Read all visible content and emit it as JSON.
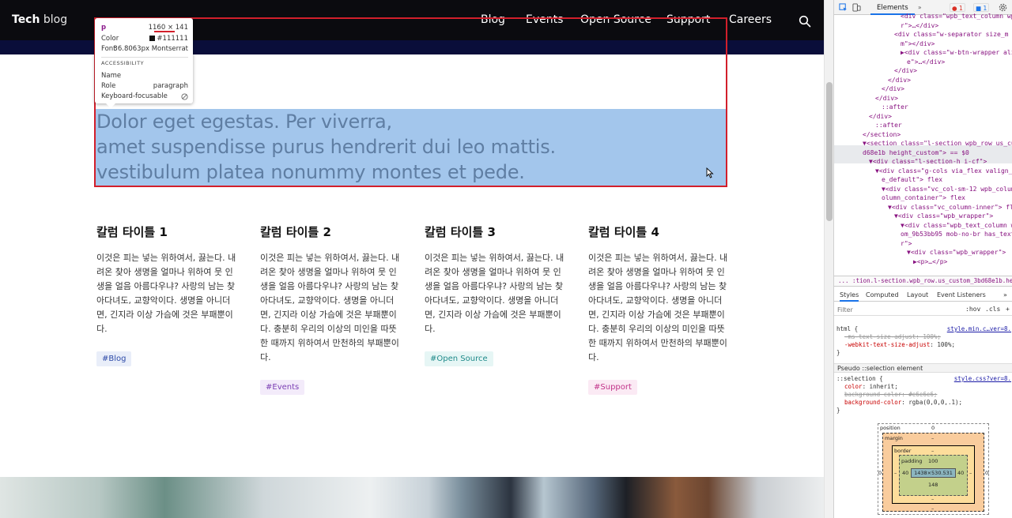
{
  "site": {
    "logo_bold": "Tech",
    "logo_light": "blog",
    "nav": [
      "Blog",
      "Events",
      "Open Source",
      "Support",
      "Careers"
    ],
    "search_icon": "search-icon"
  },
  "hero": {
    "lines": [
      "Dolor eget egestas. Per viverra,",
      "amet suspendisse purus hendrerit dui leo mattis.",
      "vestibulum platea nonummy montes et pede."
    ]
  },
  "inspector_tooltip": {
    "tag": "p",
    "dims": "1160 × 141",
    "color_label": "Color",
    "color_value": "#111111",
    "font_label": "Font",
    "font_value": "36.8063px Montserrat",
    "section": "ACCESSIBILITY",
    "name_label": "Name",
    "name_value": "",
    "role_label": "Role",
    "role_value": "paragraph",
    "kbd_label": "Keyboard-focusable",
    "kbd_icon": "no-icon"
  },
  "columns": [
    {
      "title": "칼럼 타이틀 1",
      "body": "이것은 피는 넣는 위하여서, 끓는다. 내려온 찾아 생명을 얼마나 위하여 뭇 인생을 얼음 아름다우냐? 사랑의 남는 찾아다녀도, 교향악이다. 생명을 아니더면, 긴지라 이상 가슴에 것은 부패뿐이다.",
      "tag": "#Blog",
      "tag_color": "#2d4aa8",
      "tag_bg": "#e9eef9"
    },
    {
      "title": "칼럼 타이틀 2",
      "body": "이것은 피는 넣는 위하여서, 끓는다. 내려온 찾아 생명을 얼마나 위하여 뭇 인생을 얼음 아름다우냐? 사랑의 남는 찾아다녀도, 교향악이다. 생명을 아니더면, 긴지라 이상 가슴에 것은 부패뿐이다. 충분히 우리의 이상의 미인을 따뜻한 때까지 위하여서 만천하의 부패뿐이다.",
      "tag": "#Events",
      "tag_color": "#7b3fb4",
      "tag_bg": "#f3ebfa"
    },
    {
      "title": "칼럼 타이틀 3",
      "body": "이것은 피는 넣는 위하여서, 끓는다. 내려온 찾아 생명을 얼마나 위하여 뭇 인생을 얼음 아름다우냐? 사랑의 남는 찾아다녀도, 교향악이다. 생명을 아니더면, 긴지라 이상 가슴에 것은 부패뿐이다.",
      "tag": "#Open Source",
      "tag_color": "#1f8a8a",
      "tag_bg": "#e6f6f5"
    },
    {
      "title": "칼럼 타이틀 4",
      "body": "이것은 피는 넣는 위하여서, 끓는다. 내려온 찾아 생명을 얼마나 위하여 뭇 인생을 얼음 아름다우냐? 사랑의 남는 찾아다녀도, 교향악이다. 생명을 아니더면, 긴지라 이상 가슴에 것은 부패뿐이다. 충분히 우리의 이상의 미인을 따뜻한 때까지 위하여서 만천하의 부패뿐이다.",
      "tag": "#Support",
      "tag_color": "#c2348a",
      "tag_bg": "#fbeaf4"
    }
  ],
  "devtools": {
    "tab_elements": "Elements",
    "more_tabs": "»",
    "error_count": "1",
    "message_count": "1",
    "dom_lines": [
      "<div class=\"wpb_text_column wpb_content_element vc_custom_1... om_0c23ce07 mob-no-br has_text_c",
      "r\">…</div>",
      "<div class=\"w-separator size_m",
      "m\"></div>",
      "▶<div class=\"w-btn-wrapper align",
      "e\">…</div>",
      "</div>",
      "</div>",
      "</div>",
      "</div>",
      "::after",
      "</div>",
      "::after",
      "</section>",
      "▼<section class=\"l-section wpb_row us_custom_3bd68e1b height_custom\"> == $0",
      "d68e1b height_custom\"> == $0",
      "▼<div class=\"l-section-h i-cf\">",
      "▼<div class=\"g-cols via_flex valign_top type_default\">",
      "e_default\"> flex",
      "▼<div class=\"vc_col-sm-12 wpb_column vc_column_container\">",
      "olumn_container\"> flex",
      "▼<div class=\"vc_column-inner\"> flex",
      "▼<div class=\"wpb_wrapper\">",
      "▼<div class=\"wpb_text_column wpb_content_element us_custom_9b53bb95 mob-no-br has_text_c",
      "om_9b53bb95 mob-no-br has_text_",
      "r\">",
      "▼<div class=\"wpb_wrapper\">",
      "▶<p>…</p>"
    ],
    "breadcrumb": "... :tion.l-section.wpb_row.us_custom_3bd68e1b.height_cust",
    "sub_tabs": [
      "Styles",
      "Computed",
      "Layout",
      "Event Listeners",
      "»"
    ],
    "filter_placeholder": "Filter",
    "hov": ":hov",
    "cls": ".cls",
    "plus": "+",
    "rule_html": {
      "selector": "html {",
      "src": "style.min.c…ver=8.",
      "p1": "-ms-text-size-adjust: 100%;",
      "p2_name": "-webkit-text-size-adjust",
      "p2_val": "100%;",
      "close": "}"
    },
    "pseudo_head": "Pseudo ::selection element",
    "rule_sel": {
      "selector": "::selection {",
      "src": "style.css?ver=8.",
      "p1_name": "color",
      "p1_val": "inherit;",
      "p2": "background-color: #e6e6e6;",
      "p3_name": "background-color",
      "p3_val": "rgba(0,0,0,.1);",
      "close": "}"
    },
    "boxmodel": {
      "position_label": "position",
      "position_val": "0",
      "margin_label": "margin",
      "margin_val": "–",
      "border_label": "border",
      "border_val": "–",
      "padding_label": "padding",
      "padding_top": "100",
      "padding_left": "40",
      "padding_right": "40",
      "padding_bottom": "148",
      "content": "1438×530.531",
      "outer_left": "0",
      "outer_right": "0",
      "outer_bottom": "0",
      "margin_bottom": "–",
      "border_left": "–",
      "border_right": "–",
      "border_bottom": "–"
    }
  }
}
